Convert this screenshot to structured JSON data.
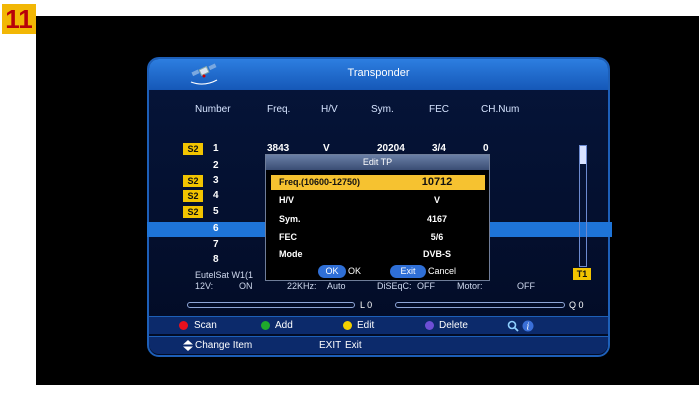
{
  "step_badge": "11",
  "window": {
    "title": "Transponder"
  },
  "table": {
    "headers": [
      "Number",
      "Freq.",
      "H/V",
      "Sym.",
      "FEC",
      "CH.Num"
    ],
    "rows": [
      {
        "badge": "S2",
        "number": "1",
        "freq": "3843",
        "hv": "V",
        "sym": "20204",
        "fec": "3/4",
        "chnum": "0"
      },
      {
        "badge": "",
        "number": "2"
      },
      {
        "badge": "S2",
        "number": "3"
      },
      {
        "badge": "S2",
        "number": "4"
      },
      {
        "badge": "S2",
        "number": "5"
      },
      {
        "badge": "",
        "number": "6"
      },
      {
        "badge": "",
        "number": "7"
      },
      {
        "badge": "",
        "number": "8"
      }
    ]
  },
  "info": {
    "satellite": "EutelSat W1(1",
    "twelve_v_label": "12V:",
    "twelve_v_value": "ON",
    "khz_label": "22KHz:",
    "khz_value": "Auto",
    "diseqc_label": "DiSEqC:",
    "diseqc_value": "OFF",
    "motor_label": "Motor:",
    "motor_value": "OFF",
    "tuner_badge": "T1"
  },
  "meters": {
    "level_label": "L 0",
    "quality_label": "Q 0",
    "level": 0,
    "quality": 0
  },
  "help": {
    "scan": "Scan",
    "add": "Add",
    "edit": "Edit",
    "delete": "Delete",
    "change_item": "Change Item",
    "exit_key": "EXIT",
    "exit": "Exit"
  },
  "dialog": {
    "title": "Edit TP",
    "freq_label": "Freq.(10600-12750)",
    "freq_value": "10712",
    "hv_label": "H/V",
    "hv_value": "V",
    "sym_label": "Sym.",
    "sym_value": "4167",
    "fec_label": "FEC",
    "fec_value": "5/6",
    "mode_label": "Mode",
    "mode_value": "DVB-S",
    "ok_button": "OK",
    "ok_text": "OK",
    "exit_button": "Exit",
    "cancel_text": "Cancel"
  },
  "colors": {
    "accent_blue": "#1e74d8",
    "badge_yellow": "#f2c400",
    "scan_red": "#e8101e",
    "add_green": "#1fa92b",
    "edit_yellow": "#f2d000",
    "delete_purple": "#6d4fd6"
  }
}
